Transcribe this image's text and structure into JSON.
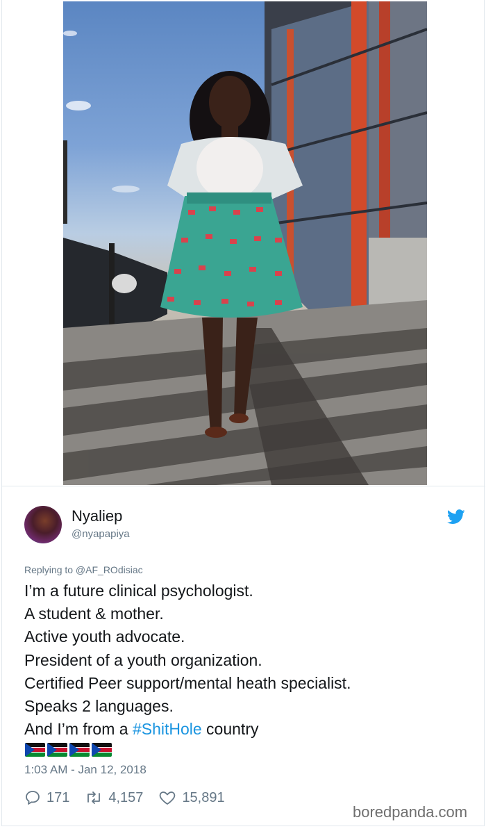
{
  "tweet": {
    "display_name": "Nyaliep",
    "handle": "@nyapapiya",
    "replying_to": "Replying to @AF_ROdisiac",
    "lines": [
      "I’m a future clinical psychologist.",
      "A student & mother.",
      "Active youth advocate.",
      "President of a youth organization.",
      "Certified Peer support/mental heath specialist.",
      "Speaks 2 languages."
    ],
    "last_line": {
      "prefix": "And I’m from a ",
      "hashtag": "#ShitHole",
      "suffix": " country"
    },
    "flags": [
      "south-sudan-flag",
      "south-sudan-flag",
      "south-sudan-flag",
      "south-sudan-flag"
    ],
    "timestamp": "1:03 AM - Jan 12, 2018",
    "stats": {
      "replies": "171",
      "retweets": "4,157",
      "likes": "15,891"
    }
  },
  "watermark": "boredpanda.com",
  "icons": {
    "brand": "twitter-bird-icon",
    "reply": "reply-icon",
    "retweet": "retweet-icon",
    "like": "heart-icon"
  },
  "colors": {
    "link": "#1b95e0",
    "muted": "#657786",
    "text": "#14171a"
  }
}
